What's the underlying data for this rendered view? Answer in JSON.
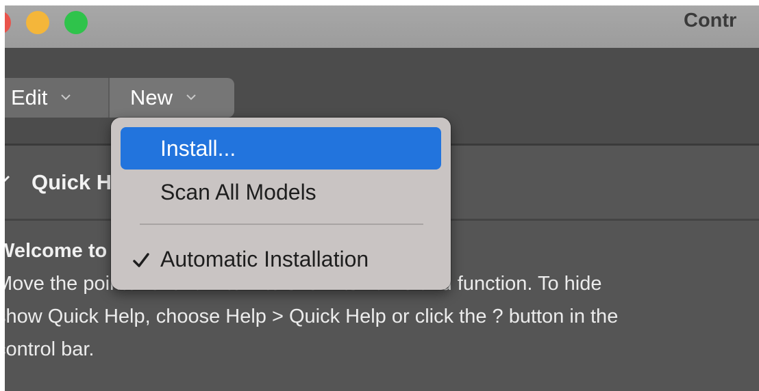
{
  "window": {
    "title": "Contr",
    "colors": {
      "close": "#e9534b",
      "minimize": "#f4b63a",
      "zoom": "#2fc34b"
    }
  },
  "toolbar": {
    "edit_label": "Edit",
    "new_label": "New"
  },
  "menu": {
    "items": [
      {
        "label": "Install...",
        "highlighted": true,
        "checked": false
      },
      {
        "label": "Scan All Models",
        "highlighted": false,
        "checked": false
      },
      {
        "label": "Automatic Installation",
        "highlighted": false,
        "checked": true
      }
    ],
    "highlight_color": "#2274dd"
  },
  "quick_help": {
    "title": "Quick Help",
    "welcome": "Welcome to Logic Pro",
    "lines": [
      "Move the pointer over an item to show its name and function. To hide",
      "show Quick Help, choose Help > Quick Help or click the ? button in the",
      "control bar."
    ]
  },
  "icons": [
    "chevron-down-icon",
    "disclosure-chevron-icon",
    "checkmark-icon"
  ]
}
